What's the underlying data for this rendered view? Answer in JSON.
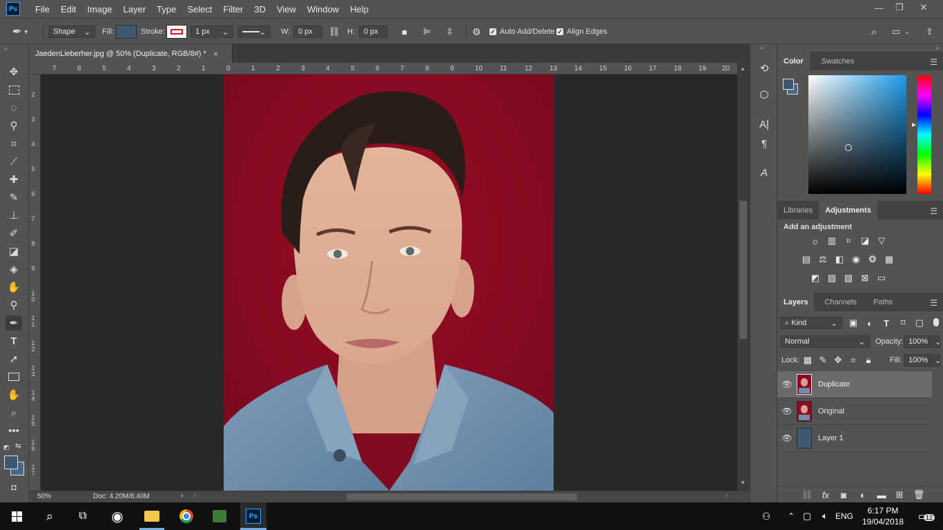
{
  "app": {
    "logo": "Ps"
  },
  "menu": [
    "File",
    "Edit",
    "Image",
    "Layer",
    "Type",
    "Select",
    "Filter",
    "3D",
    "View",
    "Window",
    "Help"
  ],
  "window_controls": {
    "minimize": "—",
    "restore": "❐",
    "close": "✕"
  },
  "options": {
    "tool_mode": "Shape",
    "fill_label": "Fill:",
    "fill_color": "#3e5870",
    "stroke_label": "Stroke:",
    "stroke_width": "1 px",
    "w_label": "W:",
    "w_value": "0 px",
    "h_label": "H:",
    "h_value": "0 px",
    "auto_add_delete": "Auto Add/Delete",
    "align_edges": "Align Edges"
  },
  "document": {
    "tab_title": "JaedenLieberher.jpg @ 50% (Duplicate, RGB/8#) *",
    "close": "×"
  },
  "ruler_top": [
    "7",
    "6",
    "5",
    "4",
    "3",
    "2",
    "1",
    "0",
    "1",
    "2",
    "3",
    "4",
    "5",
    "6",
    "7",
    "8",
    "9",
    "10",
    "11",
    "12",
    "13",
    "14",
    "15",
    "16",
    "17",
    "18",
    "19",
    "20"
  ],
  "ruler_left": [
    "2",
    "3",
    "4",
    "5",
    "6",
    "7",
    "8",
    "9",
    "1 0",
    "1 1",
    "1 2",
    "1 3",
    "1 4",
    "1 5",
    "1 6",
    "1 7"
  ],
  "status": {
    "zoom": "50%",
    "doc": "Doc: 4.20M/8.40M"
  },
  "panels": {
    "color_tabs": [
      "Color",
      "Swatches"
    ],
    "adjust_tabs": [
      "Libraries",
      "Adjustments"
    ],
    "add_adjustment": "Add an adjustment",
    "layers_tabs": [
      "Layers",
      "Channels",
      "Paths"
    ],
    "kind": "Kind",
    "blend_mode": "Normal",
    "opacity_label": "Opacity:",
    "opacity_value": "100%",
    "lock_label": "Lock:",
    "fill_label": "Fill:",
    "fill_value": "100%",
    "layers": [
      {
        "name": "Duplicate",
        "selected": true
      },
      {
        "name": "Original",
        "selected": false
      },
      {
        "name": "Layer 1",
        "selected": false
      }
    ]
  },
  "colors": {
    "foreground": "#3e5870",
    "background": "#476a8a",
    "photo_background": "#8c0a22"
  },
  "taskbar": {
    "language": "ENG",
    "time": "6:17 PM",
    "date": "19/04/2018",
    "notifications": "12",
    "app_label": "Ps"
  }
}
